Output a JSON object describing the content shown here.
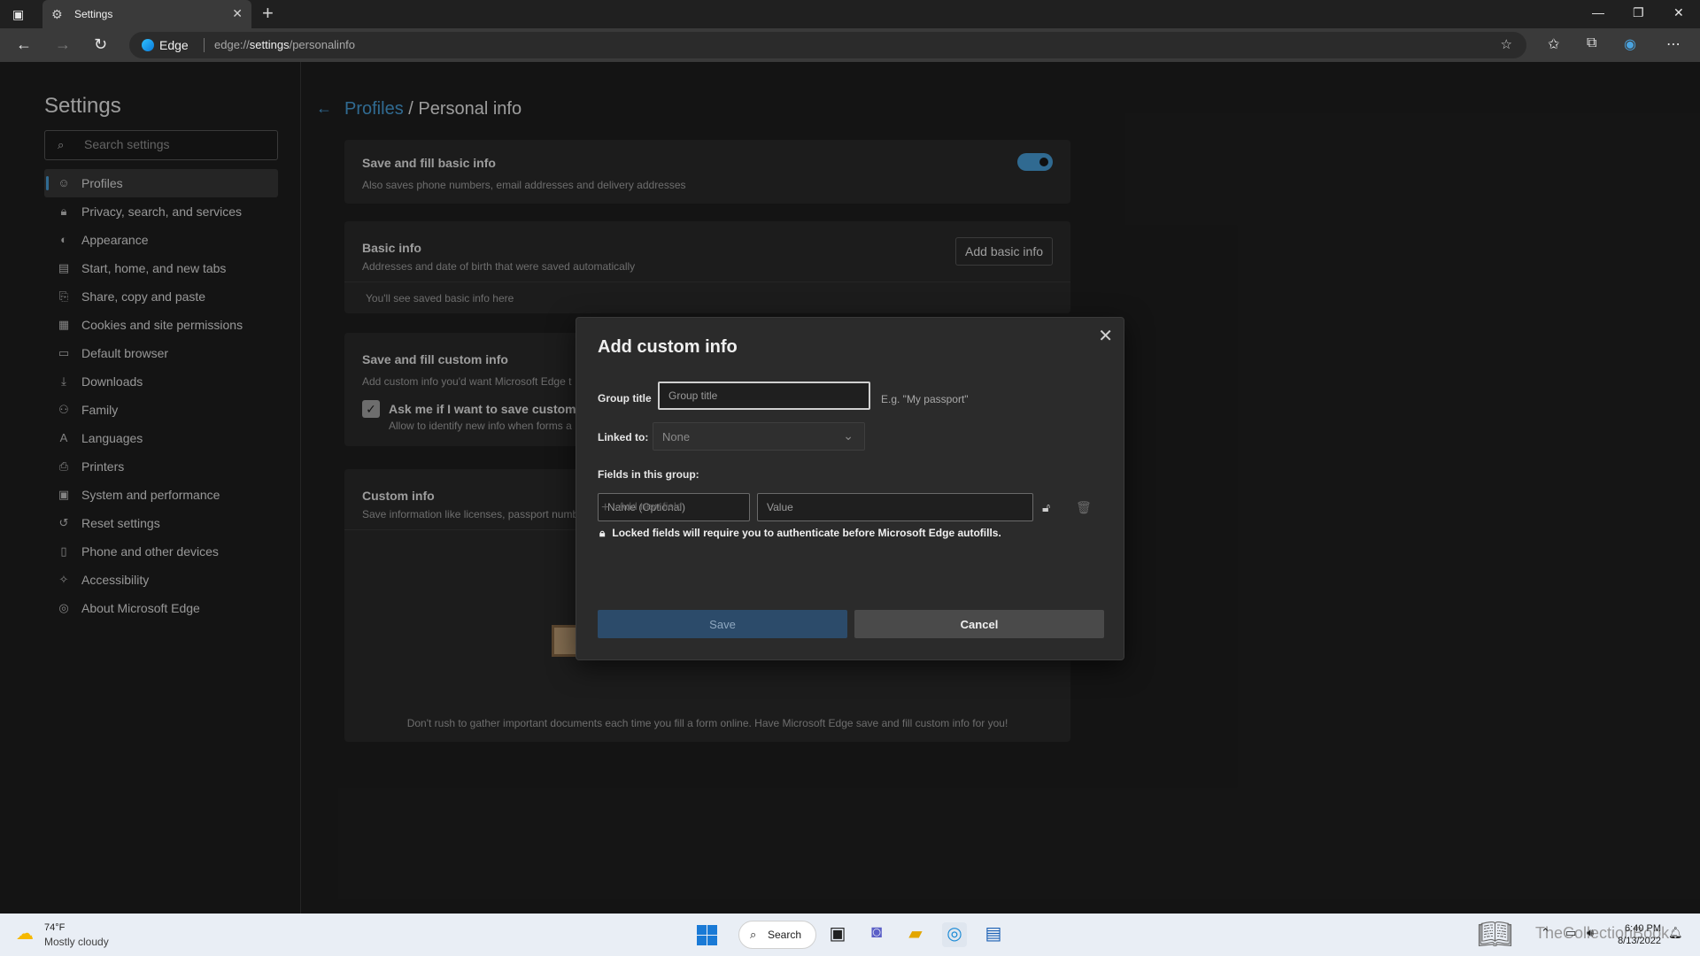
{
  "browser": {
    "tab_title": "Settings",
    "edge_label": "Edge",
    "url_prefix": "edge://",
    "url_bold": "settings",
    "url_rest": "/personalinfo"
  },
  "sidebar": {
    "title": "Settings",
    "search_placeholder": "Search settings",
    "items": [
      {
        "label": "Profiles",
        "icon": "profile-icon"
      },
      {
        "label": "Privacy, search, and services",
        "icon": "lock-icon"
      },
      {
        "label": "Appearance",
        "icon": "appearance-icon"
      },
      {
        "label": "Start, home, and new tabs",
        "icon": "home-icon"
      },
      {
        "label": "Share, copy and paste",
        "icon": "share-icon"
      },
      {
        "label": "Cookies and site permissions",
        "icon": "cookie-icon"
      },
      {
        "label": "Default browser",
        "icon": "browser-icon"
      },
      {
        "label": "Downloads",
        "icon": "download-icon"
      },
      {
        "label": "Family",
        "icon": "family-icon"
      },
      {
        "label": "Languages",
        "icon": "language-icon"
      },
      {
        "label": "Printers",
        "icon": "printer-icon"
      },
      {
        "label": "System and performance",
        "icon": "system-icon"
      },
      {
        "label": "Reset settings",
        "icon": "reset-icon"
      },
      {
        "label": "Phone and other devices",
        "icon": "phone-icon"
      },
      {
        "label": "Accessibility",
        "icon": "accessibility-icon"
      },
      {
        "label": "About Microsoft Edge",
        "icon": "edge-icon"
      }
    ]
  },
  "page": {
    "crumb_link": "Profiles",
    "crumb_sep": " / ",
    "crumb_current": "Personal info",
    "card1": {
      "title": "Save and fill basic info",
      "sub": "Also saves phone numbers, email addresses and delivery addresses",
      "toggle_on": true
    },
    "card2": {
      "title": "Basic info",
      "sub": "Addresses and date of birth that were saved automatically",
      "button": "Add basic info",
      "empty": "You'll see saved basic info here"
    },
    "card3": {
      "title": "Save and fill custom info",
      "sub": "Add custom info you'd want Microsoft Edge t",
      "check_title": "Ask me if I want to save custom i",
      "check_sub": "Allow to identify new info when forms a"
    },
    "card4": {
      "title": "Custom info",
      "sub": "Save information like licenses, passport numb",
      "footer": "Don't rush to gather important documents each time you fill a form online. Have Microsoft Edge save and fill custom info for you!"
    }
  },
  "dialog": {
    "title": "Add custom info",
    "group_title_label": "Group title",
    "group_title_placeholder": "Group title",
    "group_title_hint": "E.g. \"My passport\"",
    "linked_label": "Linked to:",
    "linked_value": "None",
    "fields_label": "Fields in this group:",
    "name_placeholder": "Name (Optional)",
    "value_placeholder": "Value",
    "add_field": "Add new field",
    "locked_note": "Locked fields will require you to authenticate before Microsoft Edge autofills.",
    "save": "Save",
    "cancel": "Cancel"
  },
  "taskbar": {
    "temp": "74°F",
    "condition": "Mostly cloudy",
    "search_label": "Search",
    "time": "6:40 PM",
    "date": "8/13/2022",
    "watermark": "TheCollectionBook"
  },
  "colors": {
    "accent": "#4aa3df",
    "background": "#202020",
    "card": "#2b2b2b"
  }
}
